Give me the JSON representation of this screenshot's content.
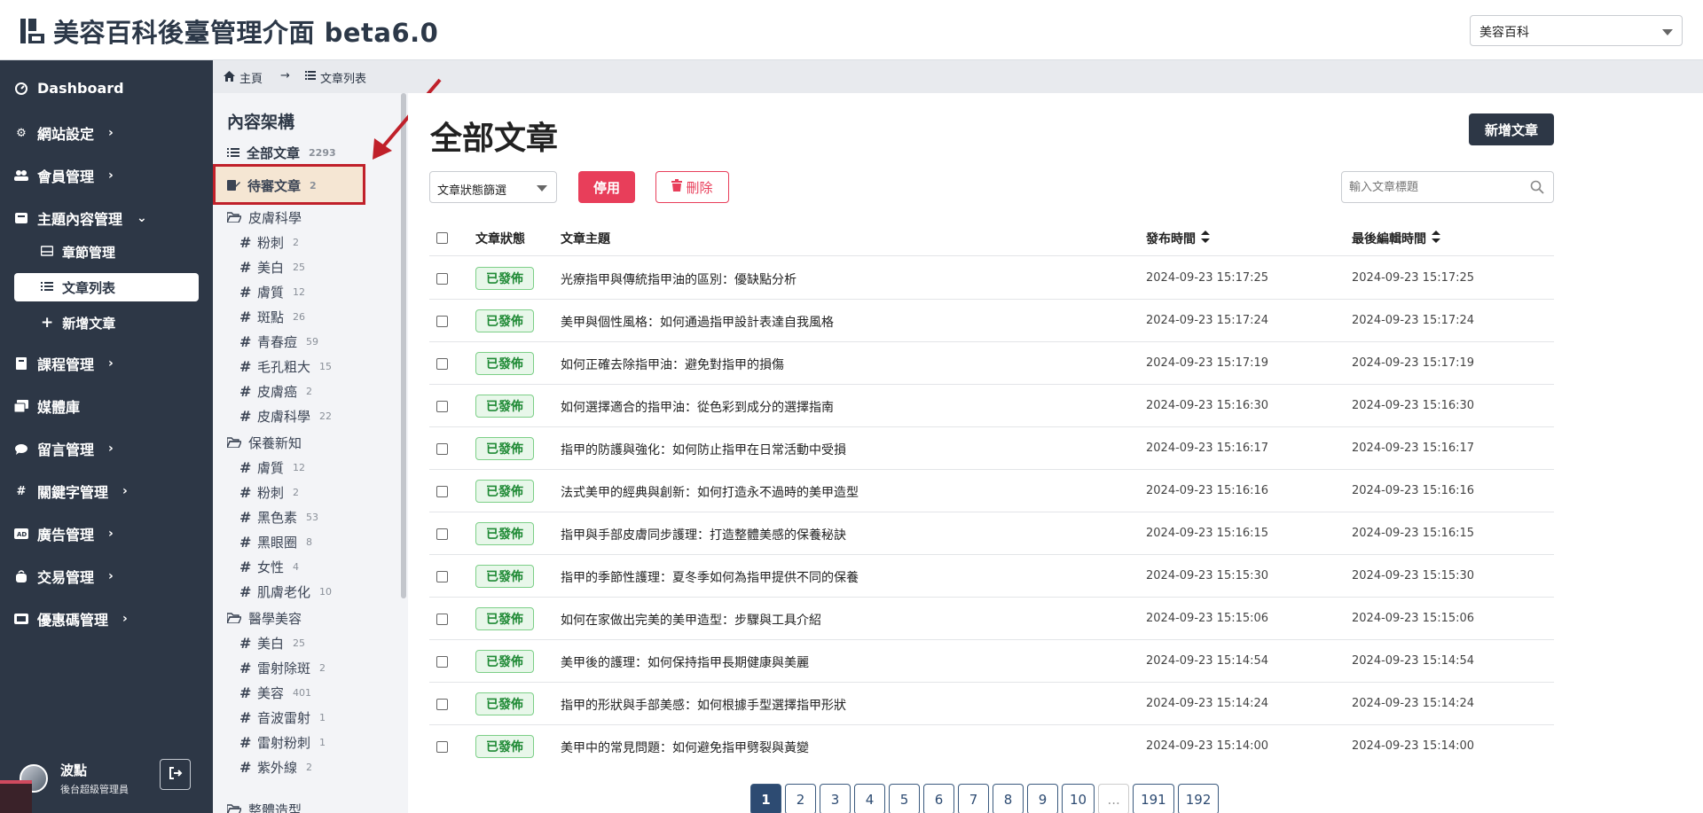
{
  "header": {
    "title": "美容百科後臺管理介面 beta6.0",
    "site_selector": "美容百科"
  },
  "sidebar": {
    "items": [
      {
        "label": "Dashboard",
        "icon": "dashboard-icon"
      },
      {
        "label": "網站設定",
        "icon": "gear-icon"
      },
      {
        "label": "會員管理",
        "icon": "users-icon"
      },
      {
        "label": "主題內容管理",
        "icon": "folder-icon"
      },
      {
        "label": "課程管理",
        "icon": "book-icon"
      },
      {
        "label": "媒體庫",
        "icon": "images-icon"
      },
      {
        "label": "留言管理",
        "icon": "comment-icon"
      },
      {
        "label": "關鍵字管理",
        "icon": "hash-icon"
      },
      {
        "label": "廣告管理",
        "icon": "ad-icon"
      },
      {
        "label": "交易管理",
        "icon": "bag-icon"
      },
      {
        "label": "優惠碼管理",
        "icon": "ticket-icon"
      }
    ],
    "sub_items": [
      {
        "label": "章節管理"
      },
      {
        "label": "文章列表"
      },
      {
        "label": "新增文章"
      }
    ],
    "user": {
      "name": "波點",
      "role": "後台超級管理員"
    }
  },
  "breadcrumb": {
    "home": "主頁",
    "current": "文章列表"
  },
  "category_panel": {
    "title": "內容架構",
    "all": {
      "label": "全部文章",
      "count": "2293"
    },
    "pending": {
      "label": "待審文章",
      "count": "2"
    },
    "groups": [
      {
        "name": "皮膚科學",
        "items": [
          {
            "label": "粉刺",
            "count": "2"
          },
          {
            "label": "美白",
            "count": "25"
          },
          {
            "label": "膚質",
            "count": "12"
          },
          {
            "label": "斑點",
            "count": "26"
          },
          {
            "label": "青春痘",
            "count": "59"
          },
          {
            "label": "毛孔粗大",
            "count": "15"
          },
          {
            "label": "皮膚癌",
            "count": "2"
          },
          {
            "label": "皮膚科學",
            "count": "22"
          }
        ]
      },
      {
        "name": "保養新知",
        "items": [
          {
            "label": "膚質",
            "count": "12"
          },
          {
            "label": "粉刺",
            "count": "2"
          },
          {
            "label": "黑色素",
            "count": "53"
          },
          {
            "label": "黑眼圈",
            "count": "8"
          },
          {
            "label": "女性",
            "count": "4"
          },
          {
            "label": "肌膚老化",
            "count": "10"
          }
        ]
      },
      {
        "name": "醫學美容",
        "items": [
          {
            "label": "美白",
            "count": "25"
          },
          {
            "label": "雷射除斑",
            "count": "2"
          },
          {
            "label": "美容",
            "count": "401"
          },
          {
            "label": "音波雷射",
            "count": "1"
          },
          {
            "label": "雷射粉刺",
            "count": "1"
          },
          {
            "label": "紫外線",
            "count": "2"
          }
        ]
      },
      {
        "name": "整體造型",
        "items": []
      }
    ]
  },
  "main": {
    "title": "全部文章",
    "new_button": "新增文章",
    "status_filter": "文章狀態篩選",
    "disable_button": "停用",
    "delete_button": "刪除",
    "search_placeholder": "輸入文章標題",
    "columns": {
      "status": "文章狀態",
      "subject": "文章主題",
      "published": "發布時間",
      "edited": "最後編輯時間"
    },
    "rows": [
      {
        "status": "已發佈",
        "title": "光療指甲與傳統指甲油的區別：優缺點分析",
        "published": "2024-09-23 15:17:25",
        "edited": "2024-09-23 15:17:25"
      },
      {
        "status": "已發佈",
        "title": "美甲與個性風格：如何通過指甲設計表達自我風格",
        "published": "2024-09-23 15:17:24",
        "edited": "2024-09-23 15:17:24"
      },
      {
        "status": "已發佈",
        "title": "如何正確去除指甲油：避免對指甲的損傷",
        "published": "2024-09-23 15:17:19",
        "edited": "2024-09-23 15:17:19"
      },
      {
        "status": "已發佈",
        "title": "如何選擇適合的指甲油：從色彩到成分的選擇指南",
        "published": "2024-09-23 15:16:30",
        "edited": "2024-09-23 15:16:30"
      },
      {
        "status": "已發佈",
        "title": "指甲的防護與強化：如何防止指甲在日常活動中受損",
        "published": "2024-09-23 15:16:17",
        "edited": "2024-09-23 15:16:17"
      },
      {
        "status": "已發佈",
        "title": "法式美甲的經典與創新：如何打造永不過時的美甲造型",
        "published": "2024-09-23 15:16:16",
        "edited": "2024-09-23 15:16:16"
      },
      {
        "status": "已發佈",
        "title": "指甲與手部皮膚同步護理：打造整體美感的保養秘訣",
        "published": "2024-09-23 15:16:15",
        "edited": "2024-09-23 15:16:15"
      },
      {
        "status": "已發佈",
        "title": "指甲的季節性護理：夏冬季如何為指甲提供不同的保養",
        "published": "2024-09-23 15:15:30",
        "edited": "2024-09-23 15:15:30"
      },
      {
        "status": "已發佈",
        "title": "如何在家做出完美的美甲造型：步驟與工具介紹",
        "published": "2024-09-23 15:15:06",
        "edited": "2024-09-23 15:15:06"
      },
      {
        "status": "已發佈",
        "title": "美甲後的護理：如何保持指甲長期健康與美麗",
        "published": "2024-09-23 15:14:54",
        "edited": "2024-09-23 15:14:54"
      },
      {
        "status": "已發佈",
        "title": "指甲的形狀與手部美感：如何根據手型選擇指甲形狀",
        "published": "2024-09-23 15:14:24",
        "edited": "2024-09-23 15:14:24"
      },
      {
        "status": "已發佈",
        "title": "美甲中的常見問題：如何避免指甲劈裂與黃變",
        "published": "2024-09-23 15:14:00",
        "edited": "2024-09-23 15:14:00"
      }
    ],
    "pagination": [
      "1",
      "2",
      "3",
      "4",
      "5",
      "6",
      "7",
      "8",
      "9",
      "10",
      "...",
      "191",
      "192"
    ]
  },
  "colors": {
    "sidebar_bg": "#2d3746",
    "danger": "#e83e5a",
    "success_badge": "#1f8a35",
    "primary_dark": "#2d4b72",
    "highlight_box": "#c0202a"
  }
}
